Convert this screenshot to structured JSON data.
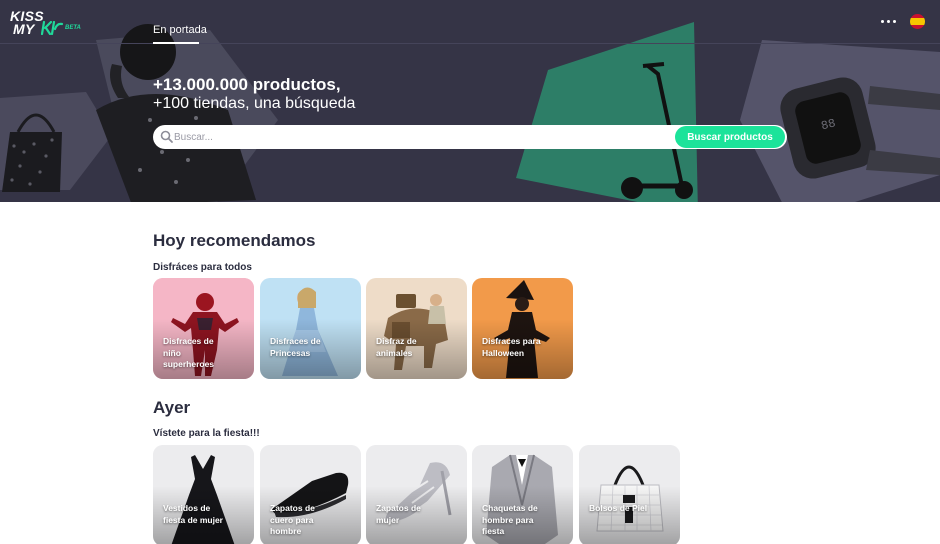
{
  "brand": {
    "logo_line1": "KISS",
    "logo_line2": "MY",
    "beta_label": "BETA"
  },
  "nav": {
    "tab_label": "En portada"
  },
  "header_icons": {
    "more": "more-dots-icon",
    "language": "spain-flag-icon"
  },
  "hero": {
    "title": "+13.000.000 productos,",
    "subtitle": "+100 tiendas, una búsqueda"
  },
  "search": {
    "placeholder": "Buscar...",
    "button_label": "Buscar productos"
  },
  "colors": {
    "accent": "#1ce39a",
    "hero_bg": "#353446",
    "text_dark": "#2b2d3f"
  },
  "sections": [
    {
      "title": "Hoy recomendamos",
      "subtitle": "Disfráces para todos",
      "cards": [
        {
          "label": "Disfraces de niño superheroes"
        },
        {
          "label": "Disfraces de Princesas"
        },
        {
          "label": "Disfraz de animales"
        },
        {
          "label": "Disfraces para Halloween"
        }
      ]
    },
    {
      "title": "Ayer",
      "subtitle": "Vístete para la fiesta!!!",
      "cards": [
        {
          "label": "Vestidos de fiesta de mujer"
        },
        {
          "label": "Zapatos de cuero para hombre"
        },
        {
          "label": "Zapatos de mujer"
        },
        {
          "label": "Chaquetas de hombre para fiesta"
        },
        {
          "label": "Bolsos de Piel"
        }
      ]
    }
  ]
}
